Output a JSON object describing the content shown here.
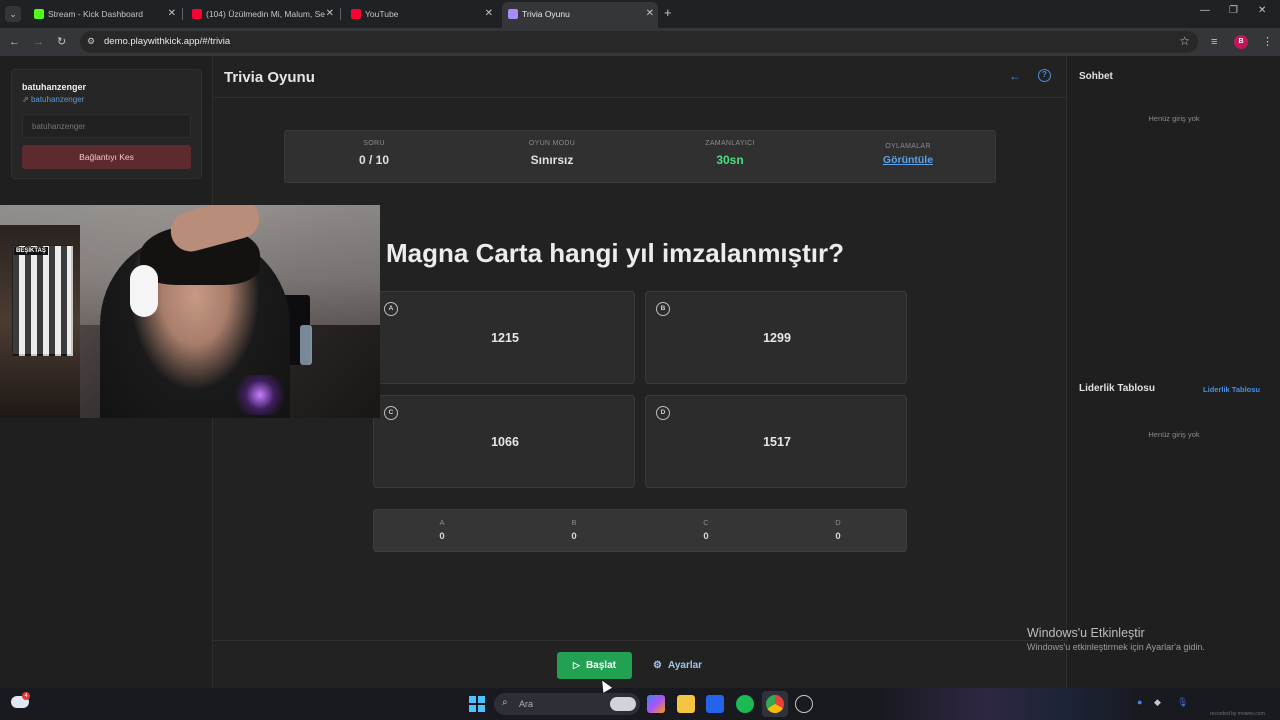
{
  "browser": {
    "tabs": [
      {
        "title": "Stream - Kick Dashboard",
        "favicon_color": "#53fc18",
        "active": false
      },
      {
        "title": "(104) Üzülmedin Mi, Malum, Se",
        "favicon_color": "#ff0033",
        "active": false
      },
      {
        "title": "YouTube",
        "favicon_color": "#ff0033",
        "active": false
      },
      {
        "title": "Trivia Oyunu",
        "favicon_color": "#a78bfa",
        "active": true
      }
    ],
    "url": "demo.playwithkick.app/#/trivia",
    "profile_initial": "B"
  },
  "connection": {
    "username": "batuhanzenger",
    "channel_link": "batuhanzenger",
    "input_placeholder": "batuhanzenger",
    "disconnect_label": "Bağlantıyı Kes"
  },
  "webcam": {
    "flag_text": "BEŞİKTAŞ"
  },
  "main": {
    "title": "Trivia Oyunu",
    "stats": [
      {
        "label": "SORU",
        "value": "0 / 10"
      },
      {
        "label": "OYUN MODU",
        "value": "Sınırsız"
      },
      {
        "label": "ZAMANLAYICI",
        "value": "30sn"
      },
      {
        "label": "OYLAMALAR",
        "value": "Görüntüle"
      }
    ],
    "question": "Magna Carta hangi yıl imzalanmıştır?",
    "answers": [
      {
        "letter": "A",
        "text": "1215"
      },
      {
        "letter": "B",
        "text": "1299"
      },
      {
        "letter": "C",
        "text": "1066"
      },
      {
        "letter": "D",
        "text": "1517"
      }
    ],
    "votes": [
      {
        "label": "A",
        "value": "0"
      },
      {
        "label": "B",
        "value": "0"
      },
      {
        "label": "C",
        "value": "0"
      },
      {
        "label": "D",
        "value": "0"
      }
    ],
    "start_label": "Başlat",
    "settings_label": "Ayarlar"
  },
  "right_panel": {
    "chat_title": "Sohbet",
    "chat_empty": "Henüz giriş yok",
    "leaderboard_title": "Liderlik Tablosu",
    "leaderboard_link": "Liderlik Tablosu",
    "leaderboard_empty": "Henüz giriş yok"
  },
  "windows_activation": {
    "title": "Windows'u Etkinleştir",
    "subtitle": "Windows'u etkinleştirmek için Ayarlar'a gidin."
  },
  "taskbar": {
    "weather_badge": "4",
    "search_placeholder": "Ara",
    "watermark": "recorded by moweo.com"
  },
  "colors": {
    "accent_green": "#22a152",
    "timer_green": "#4ade80",
    "link_blue": "#5aa2ea",
    "disconnect_red": "#5c2a2f"
  }
}
